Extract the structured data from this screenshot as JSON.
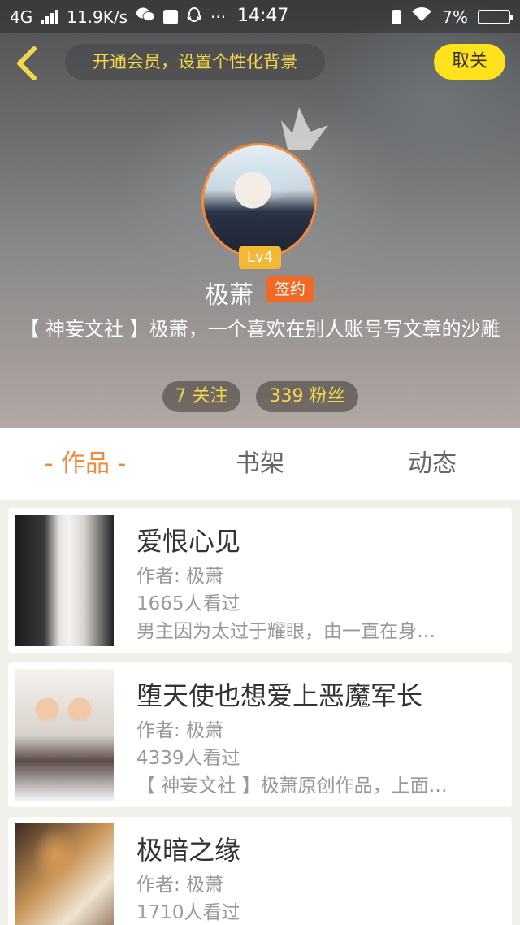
{
  "status_bar": {
    "network": "4G",
    "speed": "11.9K/s",
    "dots": "···",
    "time": "14:47",
    "battery": "7%"
  },
  "header": {
    "vip_banner": "开通会员，设置个性化背景",
    "cancel_label": "取关"
  },
  "profile": {
    "level": "Lv4",
    "name": "极萧",
    "signed_badge": "签约",
    "bio": "【 神妄文社 】极萧，一个喜欢在别人账号写文章的沙雕",
    "following": "7 关注",
    "followers": "339 粉丝"
  },
  "tabs": [
    {
      "label": "- 作品 -",
      "active": true
    },
    {
      "label": "书架",
      "active": false
    },
    {
      "label": "动态",
      "active": false
    }
  ],
  "books": [
    {
      "title": "爱恨心见",
      "author": "作者: 极萧",
      "views": "1665人看过",
      "desc": "男主因为太过于耀眼，由一直在身…"
    },
    {
      "title": "堕天使也想爱上恶魔军长",
      "author": "作者: 极萧",
      "views": "4339人看过",
      "desc": "【 神妄文社 】极萧原创作品，上面…"
    },
    {
      "title": "极暗之缘",
      "author": "作者: 极萧",
      "views": "1710人看过",
      "desc": ""
    }
  ],
  "colors": {
    "accent": "#f08a3c",
    "vip_text": "#f7d64a",
    "cancel_bg": "#ffe11c",
    "signed_bg": "#f06a26",
    "level_bg": "#f4b736"
  }
}
